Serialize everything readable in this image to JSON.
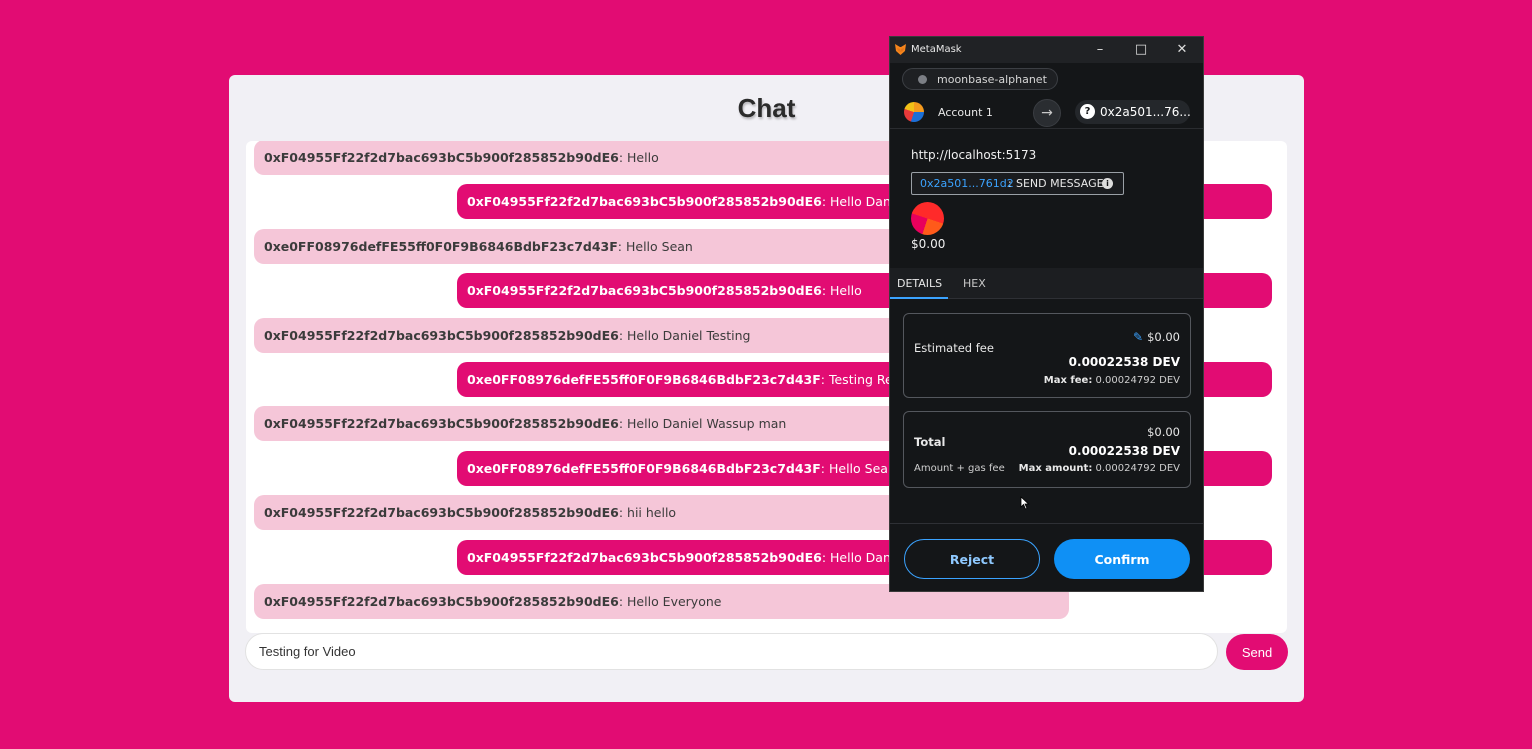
{
  "chat": {
    "title": "Chat",
    "messages": [
      {
        "side": "left",
        "address": "0xF04955Ff22f2d7bac693bC5b900f285852b90dE6",
        "text": ": Hello"
      },
      {
        "side": "right",
        "address": "0xF04955Ff22f2d7bac693bC5b900f285852b90dE6",
        "text": ": Hello Daniel"
      },
      {
        "side": "left",
        "address": "0xe0FF08976defFE55ff0F0F9B6846BdbF23c7d43F",
        "text": ": Hello Sean"
      },
      {
        "side": "right",
        "address": "0xF04955Ff22f2d7bac693bC5b900f285852b90dE6",
        "text": ": Hello"
      },
      {
        "side": "left",
        "address": "0xF04955Ff22f2d7bac693bC5b900f285852b90dE6",
        "text": ": Hello Daniel Testing"
      },
      {
        "side": "right",
        "address": "0xe0FF08976defFE55ff0F0F9B6846BdbF23c7d43F",
        "text": ": Testing Response"
      },
      {
        "side": "left",
        "address": "0xF04955Ff22f2d7bac693bC5b900f285852b90dE6",
        "text": ": Hello Daniel Wassup man"
      },
      {
        "side": "right",
        "address": "0xe0FF08976defFE55ff0F0F9B6846BdbF23c7d43F",
        "text": ": Hello Sean"
      },
      {
        "side": "left",
        "address": "0xF04955Ff22f2d7bac693bC5b900f285852b90dE6",
        "text": ": hii hello"
      },
      {
        "side": "right",
        "address": "0xF04955Ff22f2d7bac693bC5b900f285852b90dE6",
        "text": ": Hello Daniel"
      },
      {
        "side": "left",
        "address": "0xF04955Ff22f2d7bac693bC5b900f285852b90dE6",
        "text": ": Hello Everyone"
      }
    ],
    "input_value": "Testing for Video",
    "send_label": "Send"
  },
  "metamask": {
    "window_title": "MetaMask",
    "network": "moonbase-alphanet",
    "account_name": "Account 1",
    "to_address": "0x2a501...76...",
    "origin": "http://localhost:5173",
    "method_to": "0x2a501...761d2",
    "method_sep": ":",
    "method_name": "SEND MESSAGE",
    "amount": "$0.00",
    "tabs": [
      "DETAILS",
      "HEX"
    ],
    "fee": {
      "label": "Estimated fee",
      "usd": "$0.00",
      "dev": "0.00022538 DEV",
      "max_label": "Max fee:",
      "max_value": "0.00024792 DEV"
    },
    "total": {
      "label": "Total",
      "usd": "$0.00",
      "dev": "0.00022538 DEV",
      "sub_label": "Amount + gas fee",
      "max_label": "Max amount:",
      "max_value": "0.00024792 DEV"
    },
    "reject_label": "Reject",
    "confirm_label": "Confirm"
  },
  "colors": {
    "background": "#e20c73",
    "bubble_left": "#f5c6d8",
    "bubble_right": "#e20c73",
    "metamask_blue": "#0f90f5"
  },
  "icons": {
    "fox": "metamask-fox-icon",
    "minimize": "minimize-icon",
    "maximize": "maximize-icon",
    "close": "close-icon",
    "arrow": "arrow-right-icon",
    "question": "question-icon",
    "info": "info-icon",
    "edit": "edit-pencil-icon"
  }
}
